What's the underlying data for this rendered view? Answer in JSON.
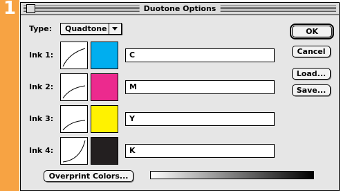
{
  "step": {
    "number": "1"
  },
  "dialog": {
    "title": "Duotone Options",
    "type_label": "Type:",
    "type_value": "Quadtone",
    "inks": [
      {
        "label": "Ink 1:",
        "name": "C",
        "color": "#00aeef"
      },
      {
        "label": "Ink 2:",
        "name": "M",
        "color": "#ec2a8e"
      },
      {
        "label": "Ink 3:",
        "name": "Y",
        "color": "#fff200"
      },
      {
        "label": "Ink 4:",
        "name": "K",
        "color": "#231f20"
      }
    ],
    "buttons": {
      "ok": "OK",
      "cancel": "Cancel",
      "load": "Load...",
      "save": "Save...",
      "overprint": "Overprint Colors..."
    }
  },
  "colors": {
    "accent": "#f7a343"
  }
}
